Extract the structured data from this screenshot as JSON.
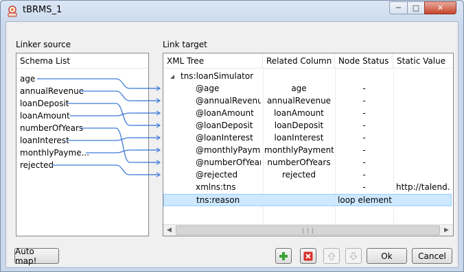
{
  "window": {
    "title": "tBRMS_1"
  },
  "linker_source": {
    "group_label": "Linker source",
    "header": "Schema List",
    "items": [
      "age",
      "annualRevenue",
      "loanDeposit",
      "loanAmount",
      "numberOfYears",
      "loanInterest",
      "monthlyPayme...",
      "rejected"
    ]
  },
  "link_target": {
    "group_label": "Link target",
    "columns": [
      "XML Tree",
      "Related Column",
      "Node Status",
      "Static Value"
    ],
    "root": "tns:loanSimulator",
    "rows": [
      {
        "tree": "@age",
        "related": "age",
        "status": "-",
        "static": ""
      },
      {
        "tree": "@annualRevenue",
        "related": "annualRevenue",
        "status": "-",
        "static": ""
      },
      {
        "tree": "@loanAmount",
        "related": "loanAmount",
        "status": "-",
        "static": ""
      },
      {
        "tree": "@loanDeposit",
        "related": "loanDeposit",
        "status": "-",
        "static": ""
      },
      {
        "tree": "@loanInterest",
        "related": "loanInterest",
        "status": "-",
        "static": ""
      },
      {
        "tree": "@monthlyPayment",
        "related": "monthlyPayment",
        "status": "-",
        "static": ""
      },
      {
        "tree": "@numberOfYears",
        "related": "numberOfYears",
        "status": "-",
        "static": ""
      },
      {
        "tree": "@rejected",
        "related": "rejected",
        "status": "-",
        "static": ""
      },
      {
        "tree": "xmlns:tns",
        "related": "",
        "status": "-",
        "static": "http://talend..."
      },
      {
        "tree": "tns:reason",
        "related": "",
        "status": "loop element",
        "static": ""
      }
    ]
  },
  "buttons": {
    "auto_map": "Auto map!",
    "ok": "Ok",
    "cancel": "Cancel"
  },
  "colors": {
    "link": "#3c7ad8",
    "selection": "#cde8ff",
    "add": "#3aa534",
    "remove": "#d9302c"
  }
}
